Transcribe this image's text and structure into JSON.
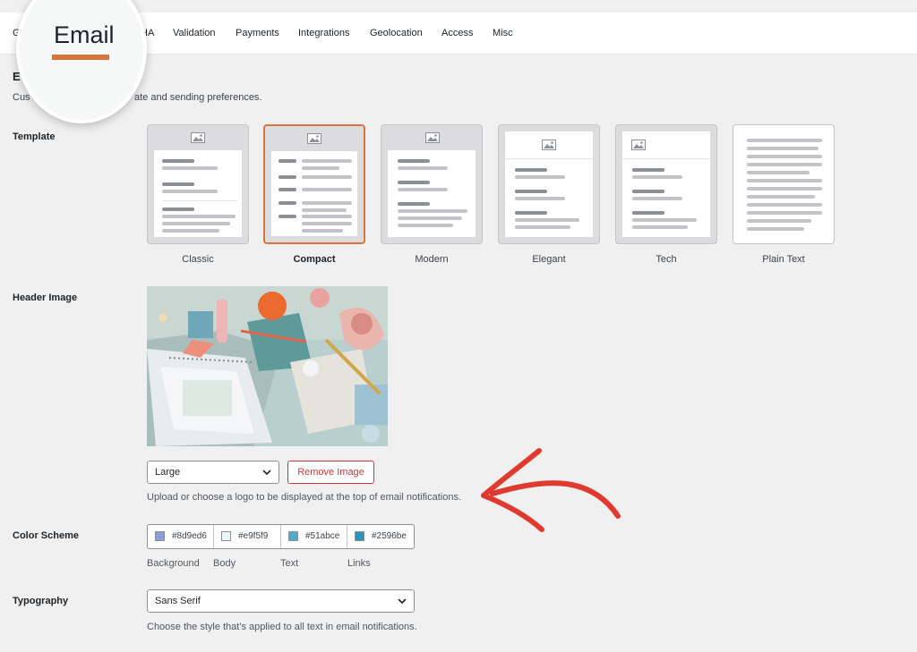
{
  "tabs": [
    {
      "label": "Ge"
    },
    {
      "label": "HA"
    },
    {
      "label": "Validation"
    },
    {
      "label": "Payments"
    },
    {
      "label": "Integrations"
    },
    {
      "label": "Geolocation"
    },
    {
      "label": "Access"
    },
    {
      "label": "Misc"
    }
  ],
  "active_tab": {
    "label": "Email",
    "accent_color": "#d9743c"
  },
  "section": {
    "title": "E",
    "description_left": "Cus",
    "description_right": "ate and sending preferences."
  },
  "template": {
    "label": "Template",
    "options": [
      {
        "name": "Classic",
        "selected": false
      },
      {
        "name": "Compact",
        "selected": true
      },
      {
        "name": "Modern",
        "selected": false
      },
      {
        "name": "Elegant",
        "selected": false
      },
      {
        "name": "Tech",
        "selected": false
      },
      {
        "name": "Plain Text",
        "selected": false
      }
    ]
  },
  "header_image": {
    "label": "Header Image",
    "size_select": {
      "value": "Large"
    },
    "remove_button": "Remove Image",
    "help": "Upload or choose a logo to be displayed at the top of email notifications."
  },
  "color_scheme": {
    "label": "Color Scheme",
    "swatches": [
      {
        "value": "#8d9ed6",
        "label": "Background"
      },
      {
        "value": "#e9f5f9",
        "label": "Body"
      },
      {
        "value": "#51abce",
        "label": "Text"
      },
      {
        "value": "#2596be",
        "label": "Links"
      }
    ]
  },
  "typography": {
    "label": "Typography",
    "select": {
      "value": "Sans Serif"
    },
    "help": "Choose the style that's applied to all text in email notifications."
  },
  "annotation": {
    "arrow_color": "#e03a2f"
  }
}
